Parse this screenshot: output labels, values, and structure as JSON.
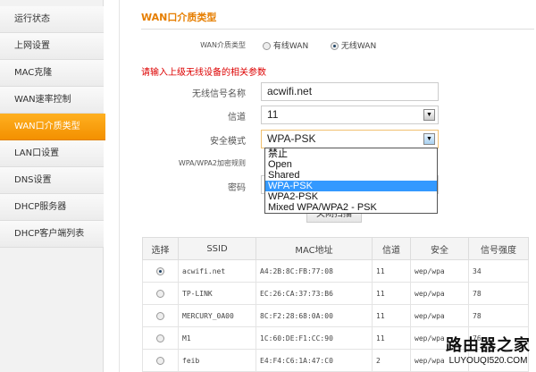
{
  "sidebar": {
    "items": [
      {
        "label": "运行状态"
      },
      {
        "label": "上网设置"
      },
      {
        "label": "MAC克隆"
      },
      {
        "label": "WAN速率控制"
      },
      {
        "label": "WAN口介质类型",
        "active": true
      },
      {
        "label": "LAN口设置"
      },
      {
        "label": "DNS设置"
      },
      {
        "label": "DHCP服务器"
      },
      {
        "label": "DHCP客户端列表"
      }
    ]
  },
  "main": {
    "title": "WAN口介质类型",
    "wan_type_label": "WAN介质类型",
    "wan_options": [
      {
        "label": "有线WAN",
        "selected": false
      },
      {
        "label": "无线WAN",
        "selected": true
      }
    ],
    "notice": "请输入上级无线设备的相关参数",
    "ssid_label": "无线信号名称",
    "ssid_value": "acwifi.net",
    "channel_label": "信道",
    "channel_value": "11",
    "security_label": "安全模式",
    "security_value": "WPA-PSK",
    "security_options": [
      "禁止",
      "Open",
      "Shared",
      "WPA-PSK",
      "WPA2-PSK",
      "Mixed WPA/WPA2 - PSK"
    ],
    "encryption_label": "WPA/WPA2加密规则",
    "password_label": "密码",
    "scan_button": "关闭扫描"
  },
  "table": {
    "headers": [
      "选择",
      "SSID",
      "MAC地址",
      "信道",
      "安全",
      "信号强度"
    ],
    "rows": [
      {
        "selected": true,
        "ssid": "acwifi.net",
        "mac": "A4:2B:8C:FB:77:08",
        "channel": "11",
        "security": "wep/wpa",
        "signal": "34"
      },
      {
        "selected": false,
        "ssid": "TP-LINK",
        "mac": "EC:26:CA:37:73:B6",
        "channel": "11",
        "security": "wep/wpa",
        "signal": "78"
      },
      {
        "selected": false,
        "ssid": "MERCURY_0A00",
        "mac": "8C:F2:28:68:0A:00",
        "channel": "11",
        "security": "wep/wpa",
        "signal": "78"
      },
      {
        "selected": false,
        "ssid": "M1",
        "mac": "1C:60:DE:F1:CC:90",
        "channel": "11",
        "security": "wep/wpa",
        "signal": "76"
      },
      {
        "selected": false,
        "ssid": "feib",
        "mac": "E4:F4:C6:1A:47:C0",
        "channel": "2",
        "security": "wep/wpa",
        "signal": ""
      }
    ]
  },
  "watermark": {
    "line1": "路由器之家",
    "line2": "LUYOUQI520.COM"
  }
}
